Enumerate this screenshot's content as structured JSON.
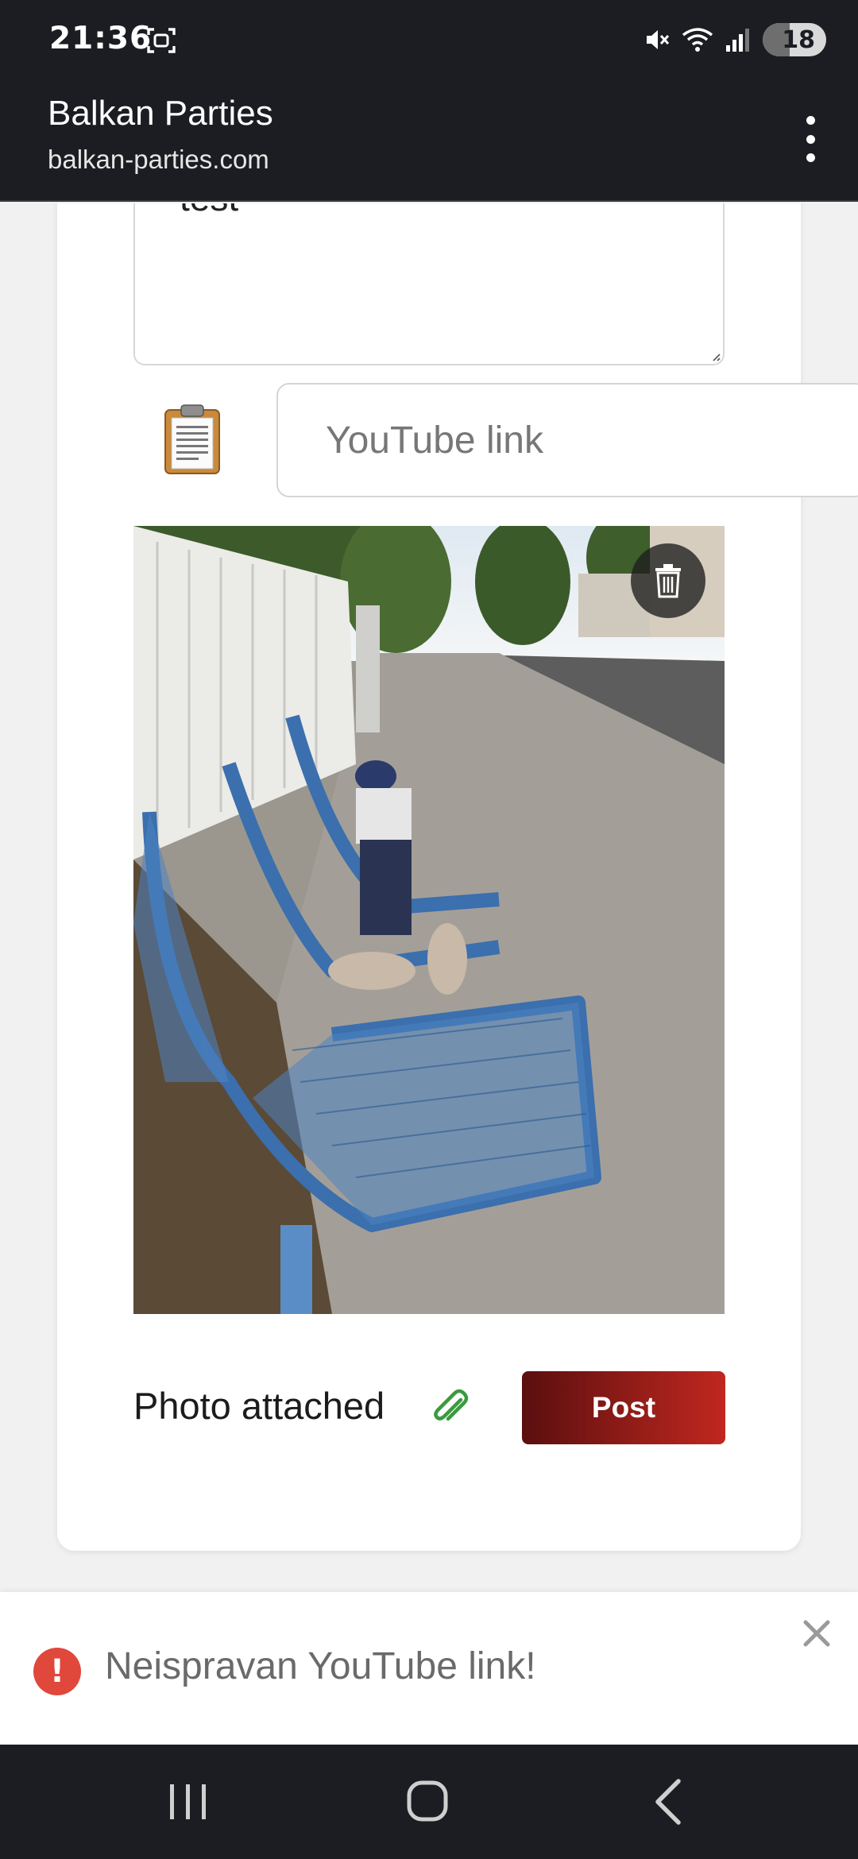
{
  "status_bar": {
    "time": "21:36",
    "battery": "18",
    "icons": [
      "screenshot-icon",
      "mute-icon",
      "wifi-icon",
      "signal-icon",
      "battery-icon"
    ]
  },
  "browser": {
    "site_title": "Balkan Parties",
    "site_url": "balkan-parties.com",
    "menu_icon": "more-vert-icon"
  },
  "form": {
    "textarea_value": "test",
    "youtube_placeholder": "YouTube link",
    "youtube_value": "",
    "attachment_status": "Photo attached",
    "post_label": "Post",
    "accent_color": "#b3241c"
  },
  "toast": {
    "message": "Neispravan YouTube link!",
    "type": "error",
    "color": "#e0483b"
  },
  "nav": {
    "buttons": [
      "recents-icon",
      "home-icon",
      "back-icon"
    ]
  }
}
